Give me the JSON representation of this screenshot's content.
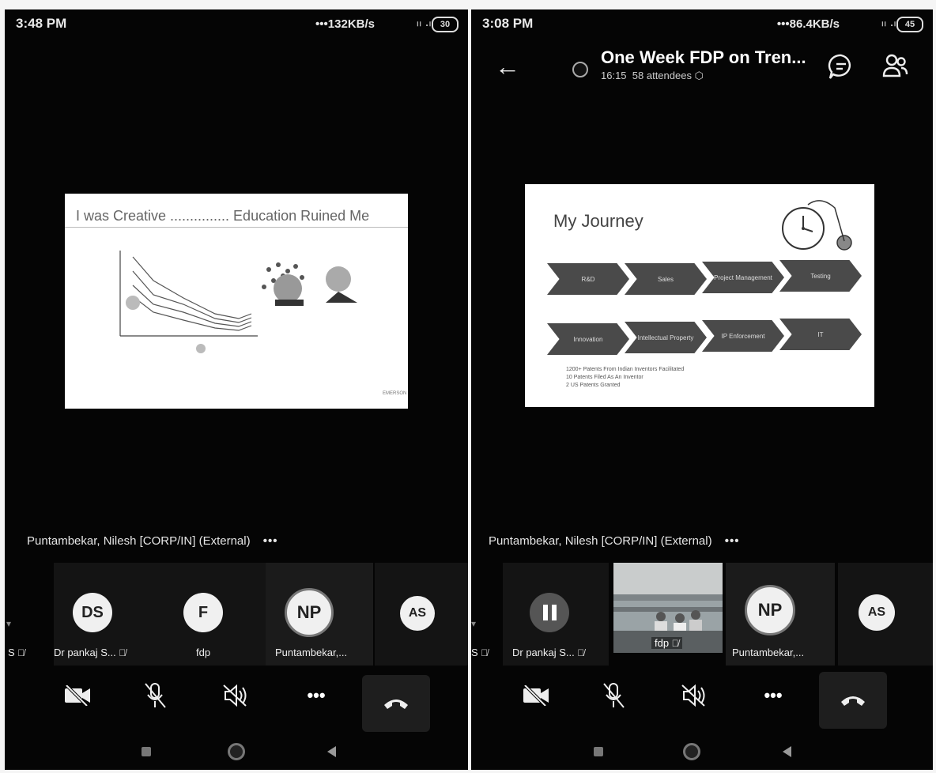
{
  "left": {
    "status": {
      "time": "3:48 PM",
      "net": "•••132KB/s",
      "signal": "ₗₗ .ₗ",
      "battery": "30"
    },
    "slide": {
      "title": "I was Creative ............... Education Ruined Me"
    },
    "presenter": {
      "name": "Puntambekar, Nilesh [CORP/IN] (External)",
      "more": "•••"
    },
    "participants": [
      {
        "initials": "DS",
        "label": "Dr pankaj S..."
      },
      {
        "initials": "F",
        "label": "fdp"
      },
      {
        "initials": "NP",
        "label": "Puntambekar,..."
      },
      {
        "initials": "AS",
        "label": ""
      }
    ],
    "edge_label": "S"
  },
  "right": {
    "status": {
      "time": "3:08 PM",
      "net": "•••86.4KB/s",
      "signal": "ₗₗ .ₗ",
      "battery": "45"
    },
    "meeting": {
      "title": "One Week FDP on Tren...",
      "duration": "16:15",
      "attendees": "58 attendees"
    },
    "slide": {
      "title": "My Journey",
      "row1": [
        "R&D",
        "Sales",
        "Project Management",
        "Testing"
      ],
      "row2": [
        "Innovation",
        "Intellectual Property",
        "IP Enforcement",
        "IT"
      ],
      "bullets": [
        "1200+ Patents From Indian Inventors Facilitated",
        "10 Patents Filed As An Inventor",
        "2 US Patents Granted"
      ]
    },
    "presenter": {
      "name": "Puntambekar, Nilesh [CORP/IN] (External)",
      "more": "•••"
    },
    "participants": [
      {
        "initials": "",
        "label": "Dr pankaj S..."
      },
      {
        "initials": "",
        "label": "fdp"
      },
      {
        "initials": "NP",
        "label": "Puntambekar,..."
      },
      {
        "initials": "AS",
        "label": ""
      }
    ],
    "edge_label": "S"
  },
  "controls": {
    "more": "•••"
  }
}
